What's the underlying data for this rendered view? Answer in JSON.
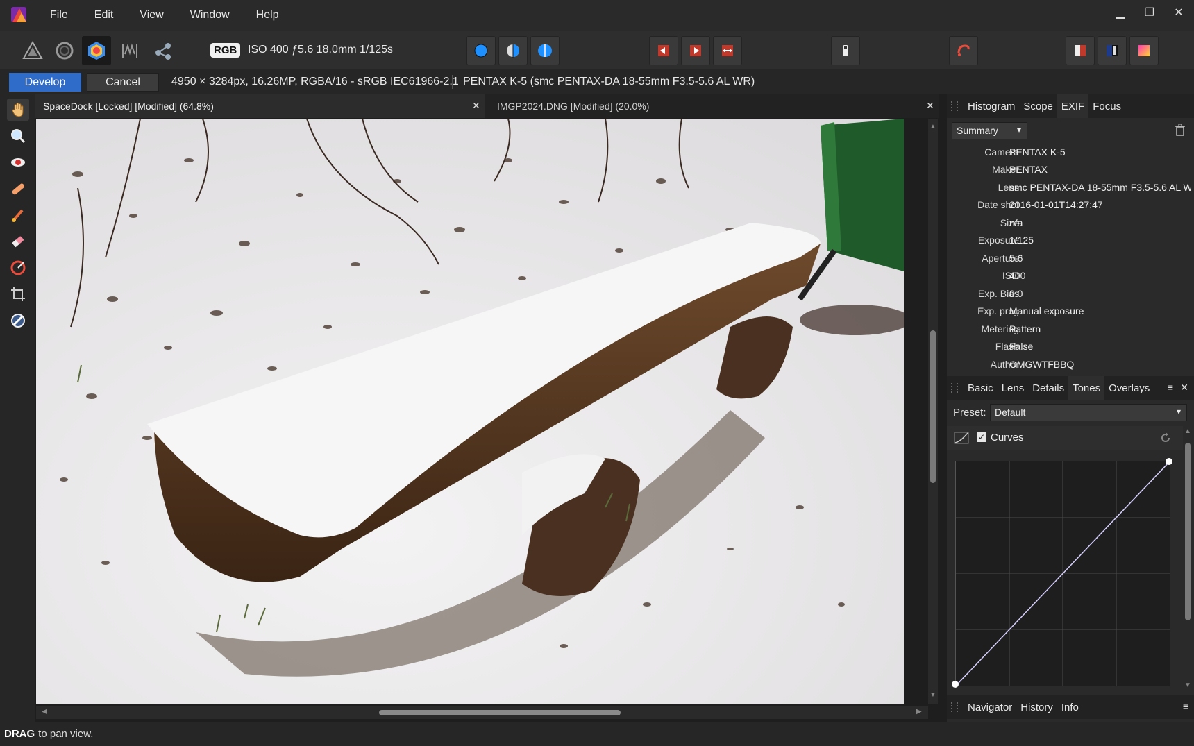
{
  "menu": {
    "items": [
      "File",
      "Edit",
      "View",
      "Window",
      "Help"
    ]
  },
  "toolbar": {
    "color_mode": "RGB",
    "exif_summary": "ISO 400 ƒ5.6 18.0mm 1/125s"
  },
  "context": {
    "develop_label": "Develop",
    "cancel_label": "Cancel",
    "image_info": "4950 × 3284px, 16.26MP, RGBA/16 - sRGB IEC61966-2.1",
    "camera_info": "PENTAX K-5 (smc PENTAX-DA 18-55mm F3.5-5.6 AL WR)"
  },
  "documents": {
    "tabs": [
      {
        "title": "SpaceDock [Locked] [Modified] (64.8%)"
      },
      {
        "title": "IMGP2024.DNG [Modified] (20.0%)"
      }
    ]
  },
  "info_panel": {
    "tabs": [
      "Histogram",
      "Scope",
      "EXIF",
      "Focus"
    ],
    "active_tab": "EXIF",
    "view_select": "Summary",
    "exif": [
      {
        "label": "Camera",
        "value": "PENTAX K-5"
      },
      {
        "label": "Maker",
        "value": "PENTAX"
      },
      {
        "label": "Lens",
        "value": "smc PENTAX-DA 18-55mm F3.5-5.6 AL W"
      },
      {
        "label": "Date shot",
        "value": "2016-01-01T14:27:47"
      },
      {
        "label": "Size",
        "value": "n/a"
      },
      {
        "label": "Exposure",
        "value": "1/125"
      },
      {
        "label": "Aperture",
        "value": "5.6"
      },
      {
        "label": "ISO",
        "value": "400"
      },
      {
        "label": "Exp. Bias",
        "value": "0.0"
      },
      {
        "label": "Exp. prog",
        "value": "Manual exposure"
      },
      {
        "label": "Metering",
        "value": "Pattern"
      },
      {
        "label": "Flash",
        "value": "False"
      },
      {
        "label": "Author",
        "value": "OMGWTFBBQ"
      }
    ]
  },
  "adjust_panel": {
    "tabs": [
      "Basic",
      "Lens",
      "Details",
      "Tones",
      "Overlays"
    ],
    "active_tab": "Tones",
    "preset_label": "Preset:",
    "preset_value": "Default",
    "curves_label": "Curves",
    "curves_enabled": true
  },
  "bottom_panel": {
    "tabs": [
      "Navigator",
      "History",
      "Info"
    ]
  },
  "status": {
    "bold": "DRAG",
    "text": "to pan view."
  },
  "colors": {
    "accent": "#2f6bc8",
    "background": "#1e1e1e"
  }
}
